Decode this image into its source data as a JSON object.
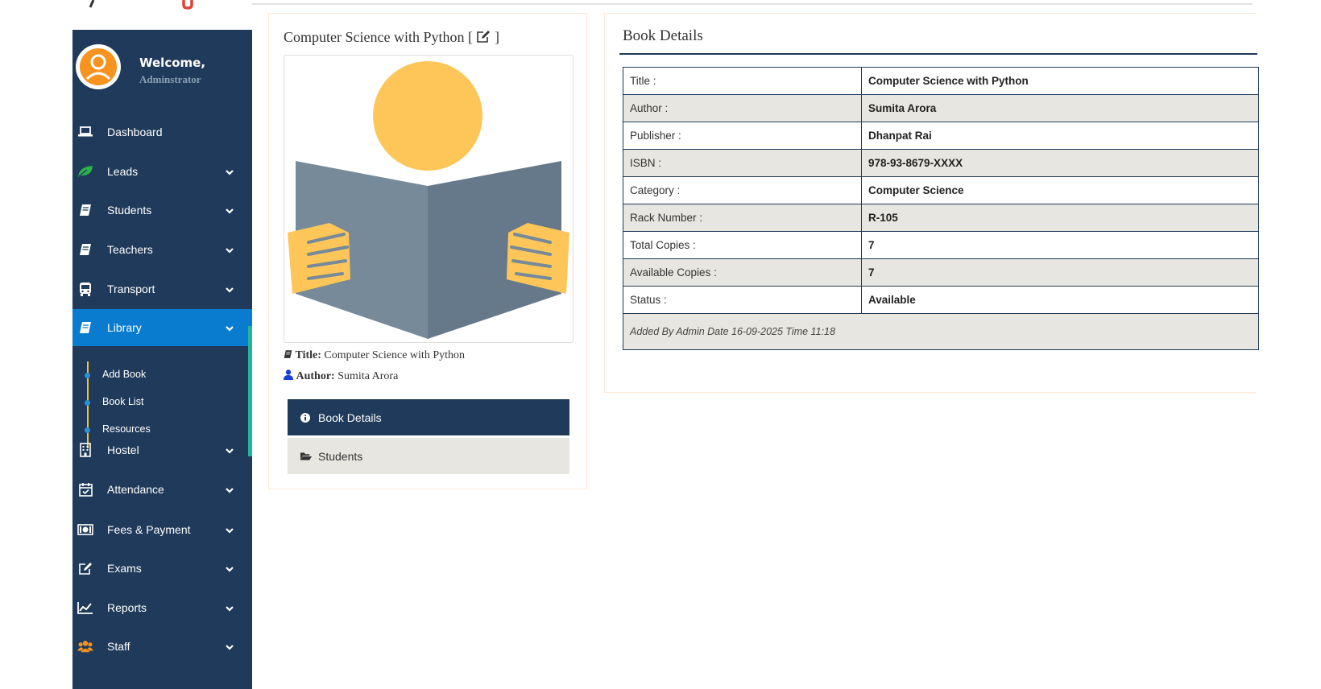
{
  "sidebar": {
    "welcome": "Welcome,",
    "role": "Adminstrator",
    "items": [
      {
        "label": "Dashboard",
        "icon": "laptop-icon",
        "has_chevron": false
      },
      {
        "label": "Leads",
        "icon": "leaf-icon",
        "has_chevron": true
      },
      {
        "label": "Students",
        "icon": "book-icon",
        "has_chevron": true
      },
      {
        "label": "Teachers",
        "icon": "book-icon",
        "has_chevron": true
      },
      {
        "label": "Transport",
        "icon": "bus-icon",
        "has_chevron": true
      },
      {
        "label": "Library",
        "icon": "book-icon",
        "has_chevron": true,
        "active": true
      },
      {
        "label": "Hostel",
        "icon": "building-icon",
        "has_chevron": true
      },
      {
        "label": "Attendance",
        "icon": "calendar-check-icon",
        "has_chevron": true
      },
      {
        "label": "Fees & Payment",
        "icon": "money-icon",
        "has_chevron": true
      },
      {
        "label": "Exams",
        "icon": "edit-icon",
        "has_chevron": true
      },
      {
        "label": "Reports",
        "icon": "line-chart-icon",
        "has_chevron": true
      },
      {
        "label": "Staff",
        "icon": "users-icon",
        "has_chevron": true
      }
    ],
    "library_submenu": [
      "Add Book",
      "Book List",
      "Resources"
    ]
  },
  "book": {
    "heading": "Computer Science with Python [",
    "heading_close": "]",
    "title_label": "Title:",
    "title": "Computer Science with Python",
    "author_label": "Author:",
    "author": "Sumita Arora"
  },
  "tabs": {
    "book_details": "Book Details",
    "students": "Students"
  },
  "details": {
    "heading": "Book Details",
    "rows": [
      {
        "key": "Title :",
        "value": "Computer Science with Python"
      },
      {
        "key": "Author :",
        "value": "Sumita Arora"
      },
      {
        "key": "Publisher :",
        "value": "Dhanpat Rai"
      },
      {
        "key": "ISBN :",
        "value": "978-93-8679-XXXX"
      },
      {
        "key": "Category :",
        "value": "Computer Science"
      },
      {
        "key": "Rack Number :",
        "value": "R-105"
      },
      {
        "key": "Total Copies :",
        "value": "7"
      },
      {
        "key": "Available Copies :",
        "value": "7"
      },
      {
        "key": "Status :",
        "value": "Available"
      }
    ],
    "footer": "Added By Admin Date 16-09-2025 Time 11:18"
  },
  "colors": {
    "sidebar_bg": "#1f3a5a",
    "active_blue": "#0a7cd0",
    "accent_teal": "#22b39a",
    "submenu_line": "#f4c430",
    "illustration_yellow": "#fec659",
    "illustration_gray": "#768a99"
  }
}
